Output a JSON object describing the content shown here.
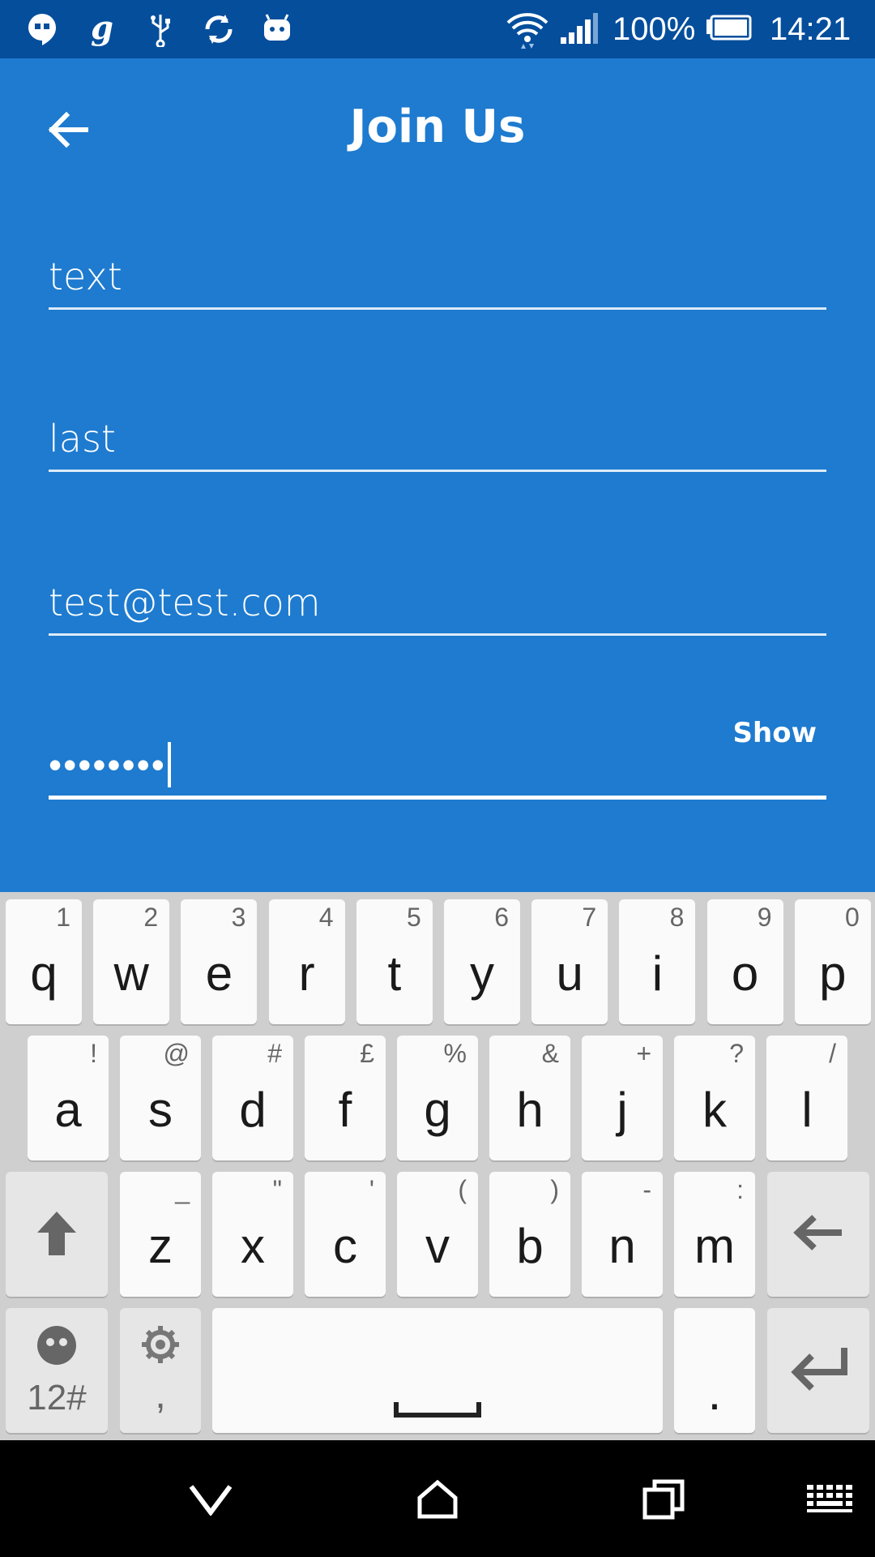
{
  "status_bar": {
    "battery": "100%",
    "time": "14:21",
    "left_icons": [
      "hangouts-icon",
      "goodreads-icon",
      "usb-icon",
      "sync-icon",
      "android-icon"
    ],
    "right_icons": [
      "wifi-icon",
      "signal-icon",
      "battery-icon"
    ]
  },
  "header": {
    "title": "Join Us",
    "back_icon": "arrow-left-icon"
  },
  "form": {
    "first_name": "text",
    "last_name": "last",
    "email": "test@test.com",
    "password_masked": "••••••••",
    "show_label": "Show"
  },
  "keyboard": {
    "row1": [
      {
        "key": "q",
        "hint": "1"
      },
      {
        "key": "w",
        "hint": "2"
      },
      {
        "key": "e",
        "hint": "3"
      },
      {
        "key": "r",
        "hint": "4"
      },
      {
        "key": "t",
        "hint": "5"
      },
      {
        "key": "y",
        "hint": "6"
      },
      {
        "key": "u",
        "hint": "7"
      },
      {
        "key": "i",
        "hint": "8"
      },
      {
        "key": "o",
        "hint": "9"
      },
      {
        "key": "p",
        "hint": "0"
      }
    ],
    "row2": [
      {
        "key": "a",
        "hint": "!"
      },
      {
        "key": "s",
        "hint": "@"
      },
      {
        "key": "d",
        "hint": "#"
      },
      {
        "key": "f",
        "hint": "£"
      },
      {
        "key": "g",
        "hint": "%"
      },
      {
        "key": "h",
        "hint": "&"
      },
      {
        "key": "j",
        "hint": "+"
      },
      {
        "key": "k",
        "hint": "?"
      },
      {
        "key": "l",
        "hint": "/"
      }
    ],
    "row3": [
      {
        "key": "z",
        "hint": "_"
      },
      {
        "key": "x",
        "hint": "\""
      },
      {
        "key": "c",
        "hint": "'"
      },
      {
        "key": "v",
        "hint": "("
      },
      {
        "key": "b",
        "hint": ")"
      },
      {
        "key": "n",
        "hint": "-"
      },
      {
        "key": "m",
        "hint": ":"
      }
    ],
    "symbols_label": "12#",
    "comma_label": ",",
    "period_label": "."
  },
  "nav_bar": {
    "icons": [
      "back-chevron-icon",
      "home-icon",
      "recents-icon",
      "keyboard-icon"
    ]
  }
}
